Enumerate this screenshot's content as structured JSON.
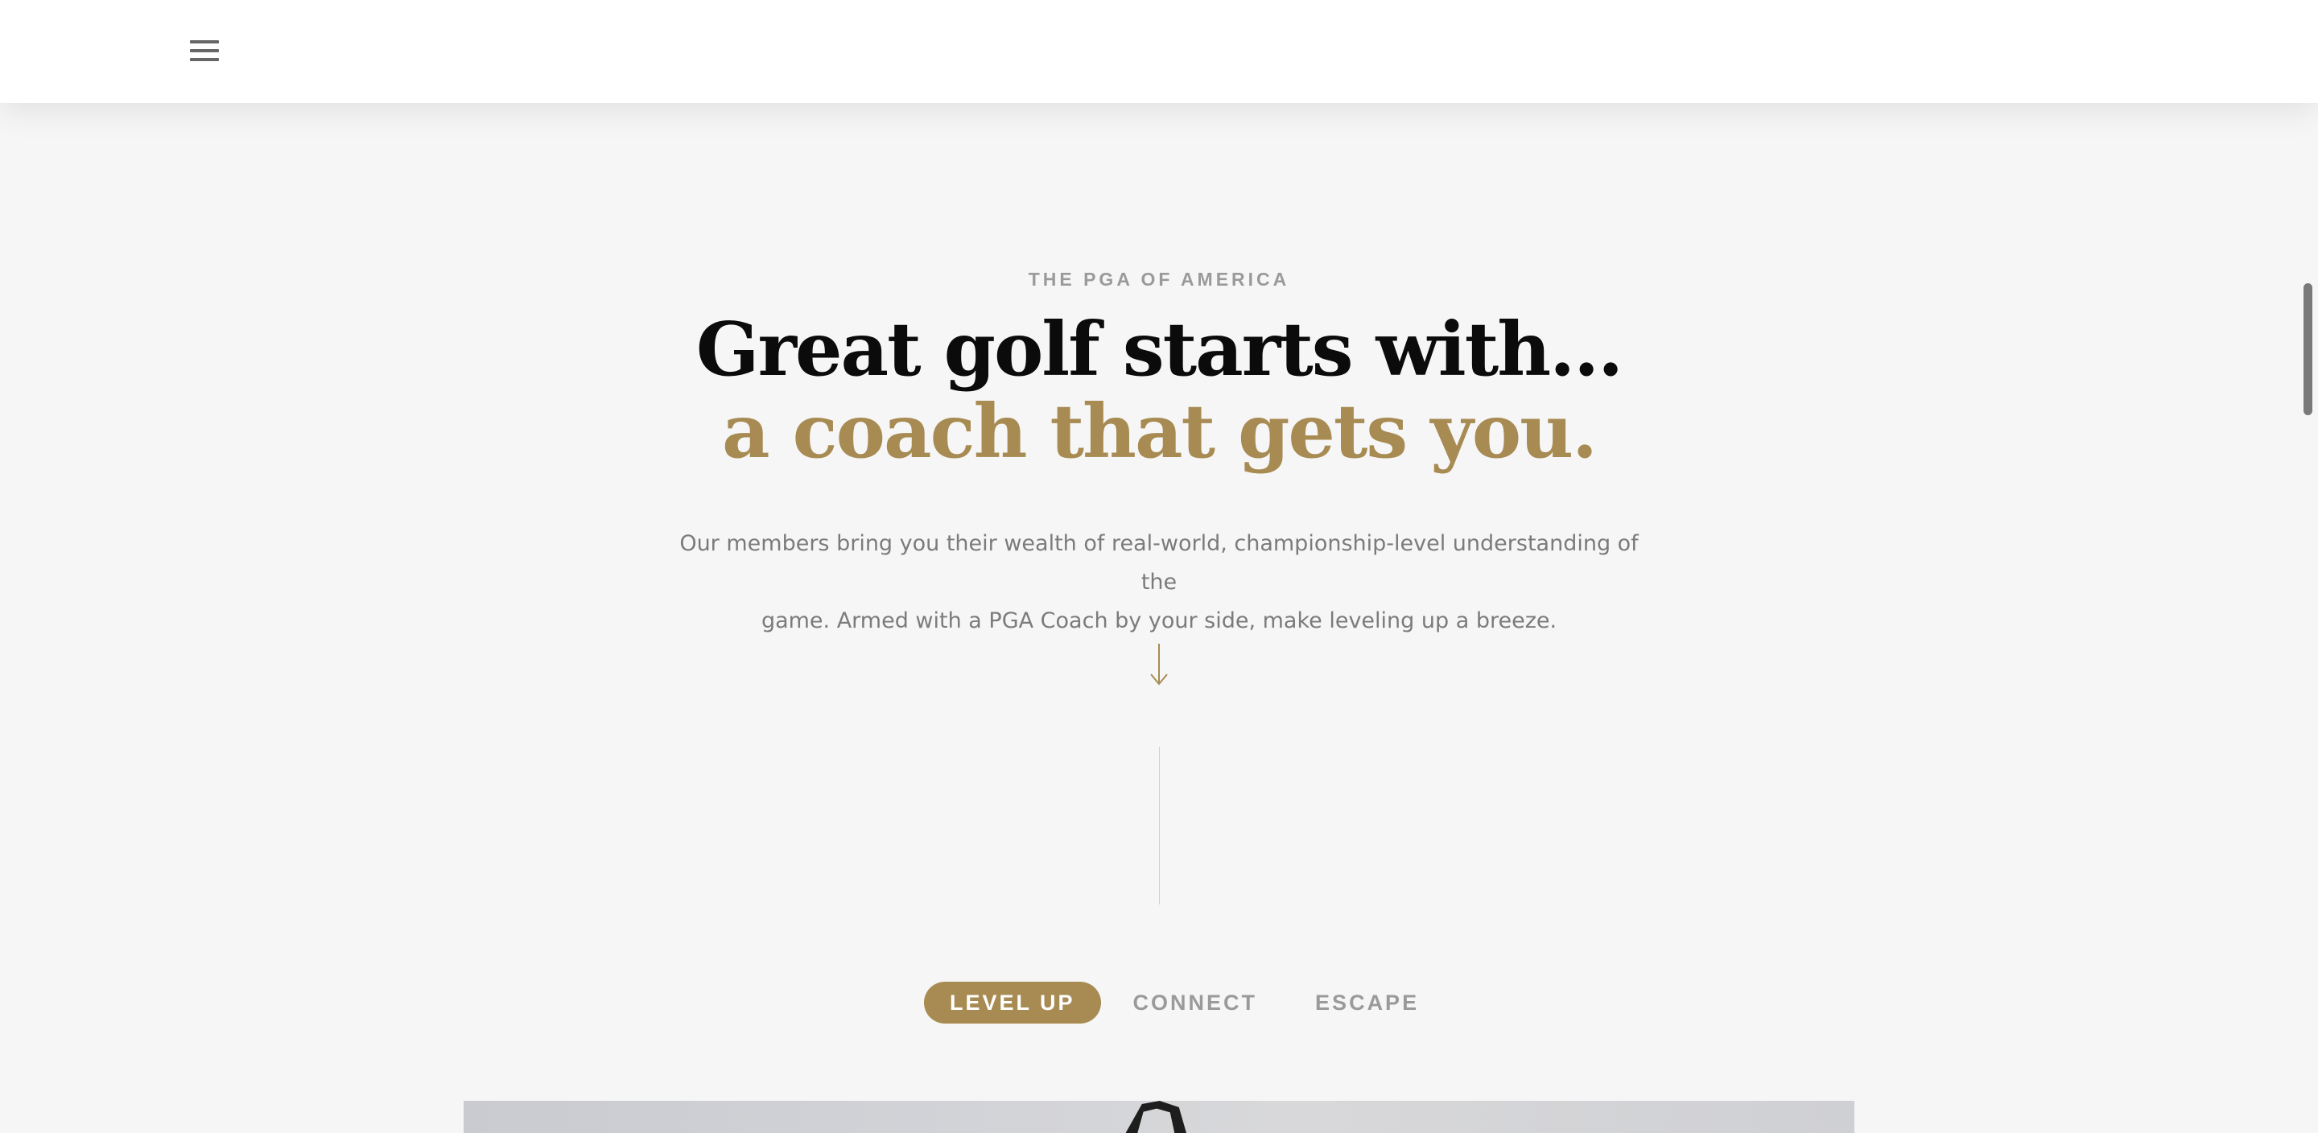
{
  "header": {
    "menu_icon": "hamburger-menu-icon"
  },
  "hero": {
    "eyebrow": "THE PGA OF AMERICA",
    "headline_line1": "Great golf starts with…",
    "headline_line2": "a coach that gets you.",
    "body_line1": "Our members bring you their wealth of real-world, championship-level understanding of the",
    "body_line2": "game. Armed with a PGA Coach by your side, make leveling up a breeze.",
    "arrow_icon": "arrow-down-icon"
  },
  "tabs": [
    {
      "label": "LEVEL UP",
      "active": true
    },
    {
      "label": "CONNECT",
      "active": false
    },
    {
      "label": "ESCAPE",
      "active": false
    }
  ],
  "colors": {
    "accent_gold": "#a78b52",
    "headline_dark": "#0b0b0b",
    "muted_text": "#9a9a9a",
    "body_text": "#7b7b7b",
    "page_background": "#f6f6f6"
  }
}
